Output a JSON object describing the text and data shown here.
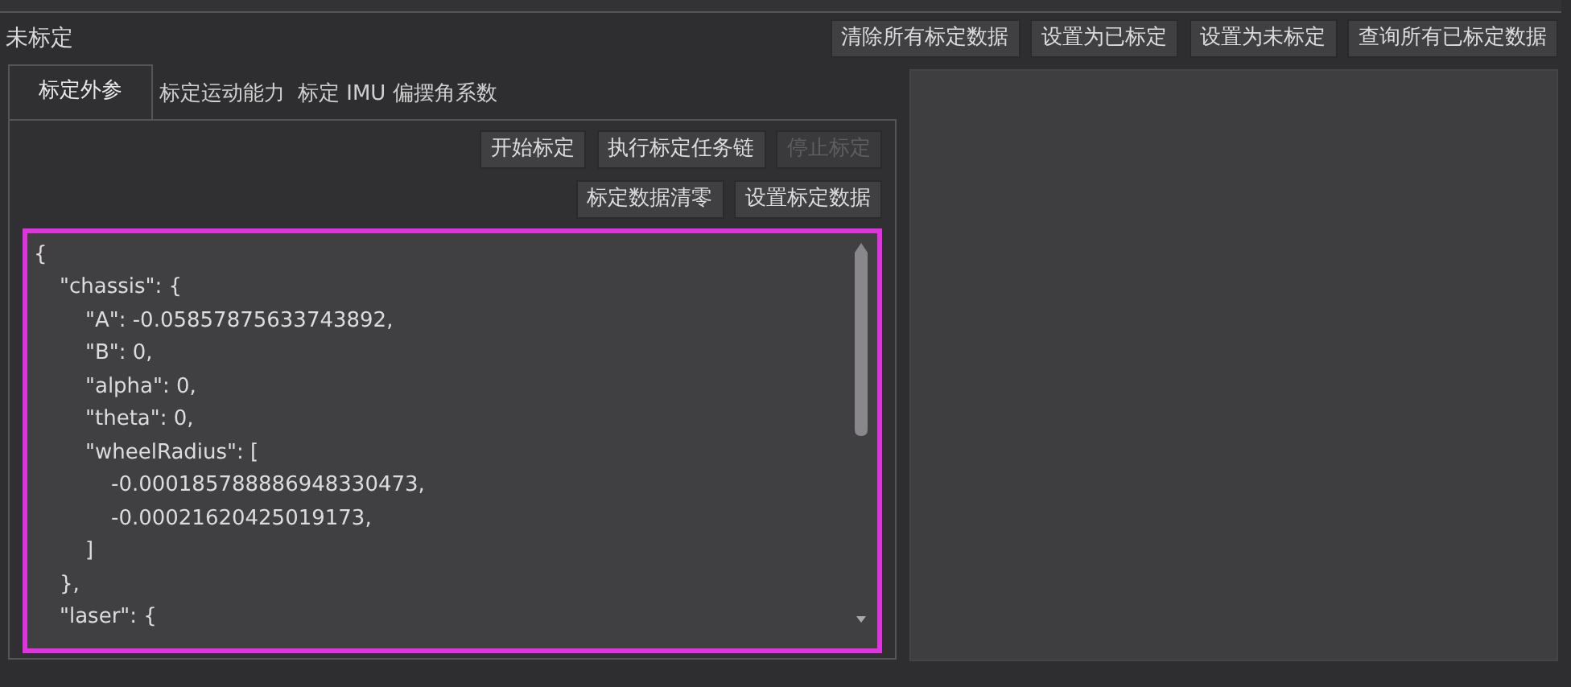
{
  "status_label": "未标定",
  "top_buttons": [
    {
      "label": "清除所有标定数据",
      "disabled": false
    },
    {
      "label": "设置为已标定",
      "disabled": false
    },
    {
      "label": "设置为未标定",
      "disabled": false
    },
    {
      "label": "查询所有已标定数据",
      "disabled": false
    }
  ],
  "tabs": [
    {
      "label": "标定外参",
      "selected": true
    },
    {
      "label": "标定运动能力",
      "selected": false
    },
    {
      "label": "标定 IMU 偏摆角系数",
      "selected": false
    }
  ],
  "action_rows": [
    [
      {
        "label": "开始标定",
        "disabled": false
      },
      {
        "label": "执行标定任务链",
        "disabled": false
      },
      {
        "label": "停止标定",
        "disabled": true
      }
    ],
    [
      {
        "label": "标定数据清零",
        "disabled": false
      },
      {
        "label": "设置标定数据",
        "disabled": false
      }
    ]
  ],
  "editor": {
    "lines": [
      {
        "text": "{",
        "children": [
          {
            "text": "\"chassis\": {",
            "children": [
              {
                "text": "\"A\": -0.05857875633743892,"
              },
              {
                "text": "\"B\": 0,"
              },
              {
                "text": "\"alpha\": 0,"
              },
              {
                "text": "\"theta\": 0,"
              },
              {
                "text": "\"wheelRadius\": [",
                "children": [
                  {
                    "text": "-0.000185788886948330473,"
                  },
                  {
                    "text": "-0.00021620425019173,"
                  }
                ]
              },
              {
                "text": "]"
              }
            ]
          },
          {
            "text": "},"
          },
          {
            "text": "\"laser\": {"
          }
        ]
      }
    ]
  }
}
